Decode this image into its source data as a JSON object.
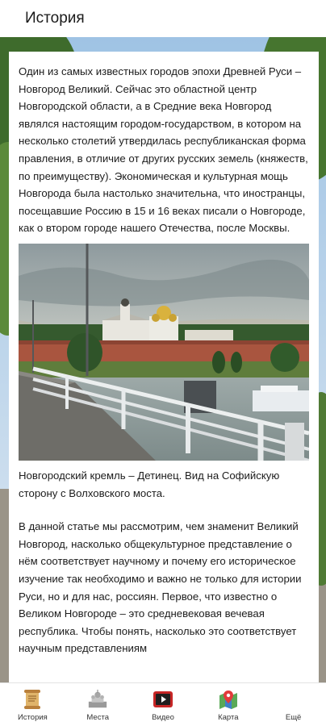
{
  "header": {
    "title": "История"
  },
  "article": {
    "intro": "Один из самых известных городов эпохи Древней Руси – Новгород Великий. Сейчас это областной центр Новгородской области, а в Средние века Новгород являлся настоящим городом-государством, в котором на несколько столетий утвердилась республиканская форма правления, в отличие от других русских земель (княжеств, по преимуществу). Экономическая и культурная мощь Новгорода была настолько значительна, что иностранцы, посещавшие Россию в 15 и 16 веках писали о Новгороде, как о втором городе нашего Отечества, после Москвы.",
    "photo_caption": "Новгородский кремль – Детинец. Вид на Софийскую сторону с Волховского моста.",
    "body": "В данной статье мы рассмотрим, чем знаменит Великий Новгород, насколько общекультурное представление о нём соответствует научному и почему его историческое изучение так необходимо и важно не только для истории Руси, но и для нас, россиян. Первое, что известно о Великом Новгороде – это средневековая вечевая республика. Чтобы понять, насколько это соответствует научным представлениям"
  },
  "tabs": [
    {
      "label": "История",
      "icon": "scroll-icon"
    },
    {
      "label": "Места",
      "icon": "kremlin-icon"
    },
    {
      "label": "Видео",
      "icon": "video-icon"
    },
    {
      "label": "Карта",
      "icon": "map-pin-icon"
    },
    {
      "label": "Ещё",
      "icon": "more-icon"
    }
  ]
}
